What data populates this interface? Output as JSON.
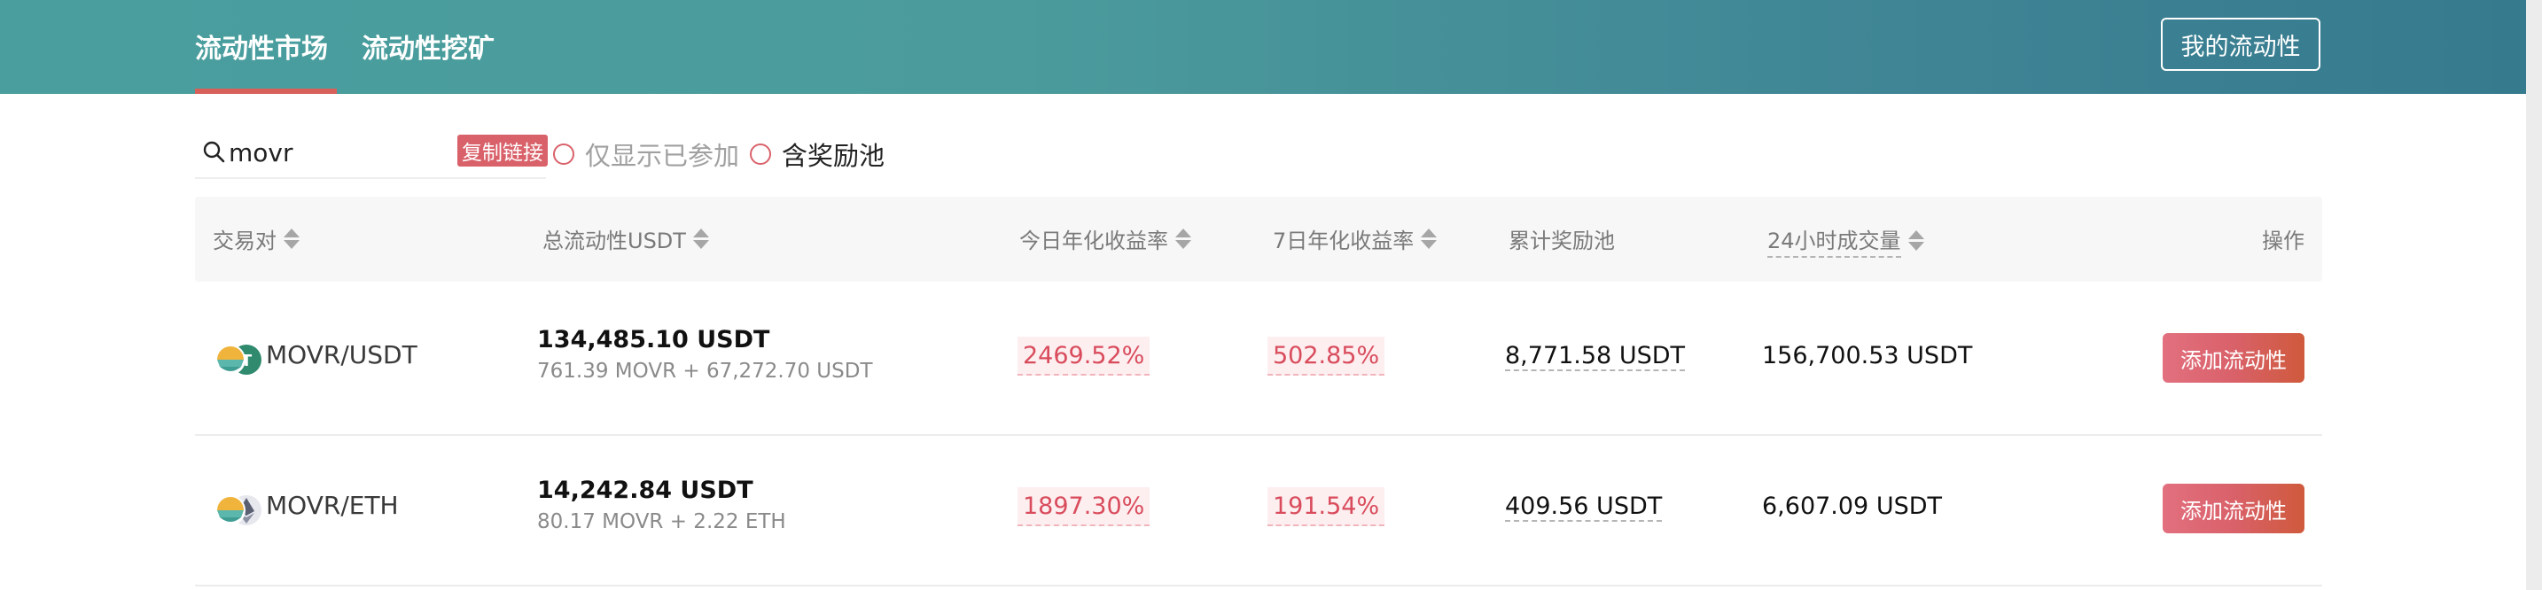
{
  "header": {
    "tabs": [
      {
        "label": "流动性市场",
        "active": true
      },
      {
        "label": "流动性挖矿",
        "active": false
      }
    ],
    "my_liquidity_label": "我的流动性"
  },
  "filters": {
    "search_value": "movr",
    "copy_link_label": "复制链接",
    "joined_only_label": "仅显示已参加",
    "with_reward_label": "含奖励池"
  },
  "table": {
    "columns": [
      "交易对",
      "总流动性USDT",
      "今日年化收益率",
      "7日年化收益率",
      "累计奖励池",
      "24小时成交量",
      "操作"
    ],
    "rows": [
      {
        "pair": "MOVR/USDT",
        "pair_icons": [
          "movr-token-icon",
          "usdt-token-icon"
        ],
        "liquidity": "134,485.10 USDT",
        "liquidity_detail": "761.39 MOVR + 67,272.70 USDT",
        "apr_today": "2469.52%",
        "apr_7d": "502.85%",
        "reward_pool": "8,771.58 USDT",
        "volume_24h": "156,700.53 USDT",
        "action_label": "添加流动性"
      },
      {
        "pair": "MOVR/ETH",
        "pair_icons": [
          "movr-token-icon",
          "eth-token-icon"
        ],
        "liquidity": "14,242.84 USDT",
        "liquidity_detail": "80.17 MOVR + 2.22 ETH",
        "apr_today": "1897.30%",
        "apr_7d": "191.54%",
        "reward_pool": "409.56 USDT",
        "volume_24h": "6,607.09 USDT",
        "action_label": "添加流动性"
      }
    ]
  },
  "colors": {
    "banner_start": "#4a9e9e",
    "banner_end": "#367a8e",
    "accent": "#d9616a",
    "apr_text": "#d94c5c"
  }
}
